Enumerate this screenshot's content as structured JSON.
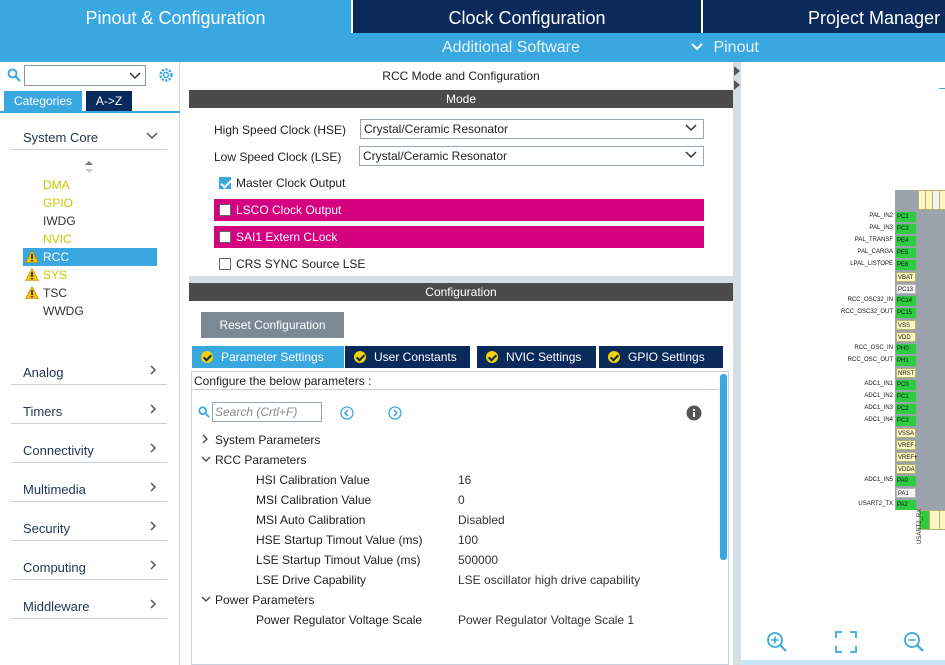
{
  "top_tabs": [
    {
      "label": "Pinout & Configuration",
      "active": true
    },
    {
      "label": "Clock Configuration",
      "active": false
    },
    {
      "label": "Project Manager",
      "active": false
    }
  ],
  "sub_bar": {
    "additional_software": "Additional Software",
    "pinout": "Pinout"
  },
  "sidebar": {
    "tab_categories": "Categories",
    "tab_az": "A->Z",
    "system_core": "System Core",
    "core_items": [
      {
        "label": "DMA",
        "color": "#c8c800",
        "warn": false
      },
      {
        "label": "GPIO",
        "color": "#c8c800",
        "warn": false
      },
      {
        "label": "IWDG",
        "color": "#333333",
        "warn": false
      },
      {
        "label": "NVIC",
        "color": "#c8c800",
        "warn": false
      },
      {
        "label": "RCC",
        "color": "#ffffff",
        "warn": true,
        "selected": true
      },
      {
        "label": "SYS",
        "color": "#c8c800",
        "warn": true
      },
      {
        "label": "TSC",
        "color": "#333333",
        "warn": true
      },
      {
        "label": "WWDG",
        "color": "#333333",
        "warn": false
      }
    ],
    "sections": [
      "Analog",
      "Timers",
      "Connectivity",
      "Multimedia",
      "Security",
      "Computing",
      "Middleware"
    ]
  },
  "rcc": {
    "title": "RCC Mode and Configuration",
    "mode_bar": "Mode",
    "hse_label": "High Speed Clock (HSE)",
    "hse_value": "Crystal/Ceramic Resonator",
    "lse_label": "Low Speed Clock (LSE)",
    "lse_value": "Crystal/Ceramic Resonator",
    "mco": "Master Clock Output",
    "lsco": "LSCO Clock Output",
    "sai1": "SAI1 Extern CLock",
    "crs": "CRS SYNC Source LSE",
    "config_bar": "Configuration",
    "reset_button": "Reset Configuration",
    "tabs": [
      "Parameter Settings",
      "User Constants",
      "NVIC Settings",
      "GPIO Settings"
    ],
    "configure_text": "Configure the below parameters :",
    "search_placeholder": "Search (Crtl+F)",
    "groups": {
      "system": "System Parameters",
      "rcc": "RCC Parameters",
      "power": "Power Parameters"
    },
    "params": [
      {
        "name": "HSI Calibration Value",
        "value": "16"
      },
      {
        "name": "MSI Calibration Value",
        "value": "0"
      },
      {
        "name": "MSI Auto Calibration",
        "value": "Disabled"
      },
      {
        "name": "HSE Startup Timout Value (ms)",
        "value": "100"
      },
      {
        "name": "LSE Startup Timout Value (ms)",
        "value": "500000"
      },
      {
        "name": "LSE Drive Capability",
        "value": "LSE oscillator high drive capability"
      }
    ],
    "power_params": [
      {
        "name": "Power Regulator Voltage Scale",
        "value": "Power Regulator Voltage Scale 1"
      }
    ]
  },
  "pinout": {
    "pins": [
      {
        "signal": "PAL_IN2",
        "pin": "PC1",
        "kind": "g"
      },
      {
        "signal": "PAL_IN3",
        "pin": "PC3",
        "kind": "g"
      },
      {
        "signal": "PAL_TRANSF",
        "pin": "PE4",
        "kind": "g"
      },
      {
        "signal": "PAL_CARGA",
        "pin": "PE5",
        "kind": "g"
      },
      {
        "signal": "LPAL_LISTOPE",
        "pin": "PE6",
        "kind": "g"
      },
      {
        "signal": "",
        "pin": "VBAT",
        "kind": "y"
      },
      {
        "signal": "",
        "pin": "PC13",
        "kind": "w"
      },
      {
        "signal": "RCC_OSC32_IN",
        "pin": "PC14",
        "kind": "g"
      },
      {
        "signal": "RCC_OSC32_OUT",
        "pin": "PC15",
        "kind": "g"
      },
      {
        "signal": "",
        "pin": "VSS",
        "kind": "y"
      },
      {
        "signal": "",
        "pin": "VDD",
        "kind": "y"
      },
      {
        "signal": "RCC_OSC_IN",
        "pin": "PH0",
        "kind": "g"
      },
      {
        "signal": "RCC_OSC_OUT",
        "pin": "PH1",
        "kind": "g"
      },
      {
        "signal": "",
        "pin": "NRST",
        "kind": "y"
      },
      {
        "signal": "ADC1_IN1",
        "pin": "PC0",
        "kind": "g"
      },
      {
        "signal": "ADC1_IN2",
        "pin": "PC1",
        "kind": "g"
      },
      {
        "signal": "ADC1_IN3",
        "pin": "PC2",
        "kind": "g"
      },
      {
        "signal": "ADC1_IN4",
        "pin": "PC3",
        "kind": "g"
      },
      {
        "signal": "",
        "pin": "VSSA",
        "kind": "y"
      },
      {
        "signal": "",
        "pin": "VREF-",
        "kind": "y"
      },
      {
        "signal": "",
        "pin": "VREF+",
        "kind": "y"
      },
      {
        "signal": "",
        "pin": "VDDA",
        "kind": "y"
      },
      {
        "signal": "ADC1_IN5",
        "pin": "PA0",
        "kind": "g"
      },
      {
        "signal": "",
        "pin": "PA1",
        "kind": "w"
      },
      {
        "signal": "USART2_TX",
        "pin": "PA2",
        "kind": "g"
      }
    ],
    "bottom_label": "USART2_RX"
  }
}
